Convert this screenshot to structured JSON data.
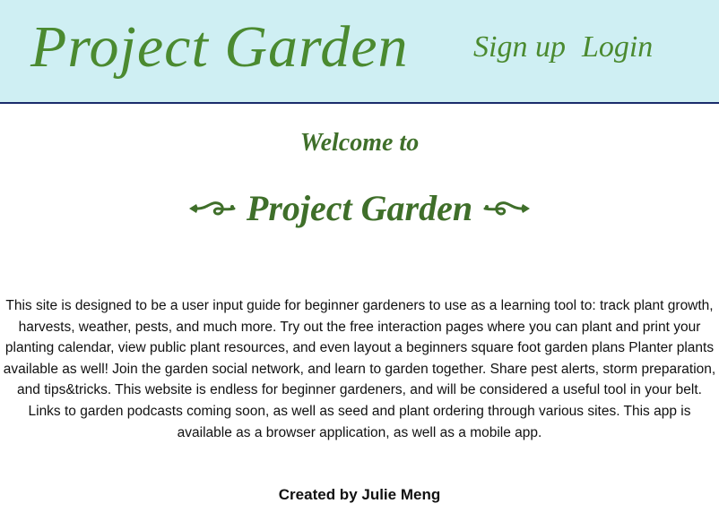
{
  "header": {
    "site_title": "Project Garden",
    "nav": {
      "signup_label": "Sign up",
      "login_label": "Login"
    }
  },
  "main": {
    "welcome_text": "Welcome to",
    "hero_title": "Project Garden",
    "description": "This site is designed to be a user input guide for beginner gardeners to use as a learning tool to: track plant growth, harvests, weather, pests, and much more. Try out the free interaction pages where you can plant and print your planting calendar, view public plant resources, and even layout a beginners square foot garden plans Planter plants available as well! Join the garden social network, and learn to garden together. Share pest alerts, storm preparation, and tips&tricks. This website is endless for beginner gardeners, and will be considered a useful tool in your belt. Links to garden podcasts coming soon, as well as seed and plant ordering through various sites. This app is available as a browser application, as well as a mobile app."
  },
  "footer": {
    "credit": "Created by Julie Meng"
  },
  "colors": {
    "header_background": "#cfeff3",
    "header_border": "#1a2b6b",
    "brand_green": "#4b8a30",
    "dark_green": "#3f6f2a"
  },
  "icons": {
    "left_flourish": "scroll-flourish-left-icon",
    "right_flourish": "scroll-flourish-right-icon"
  }
}
